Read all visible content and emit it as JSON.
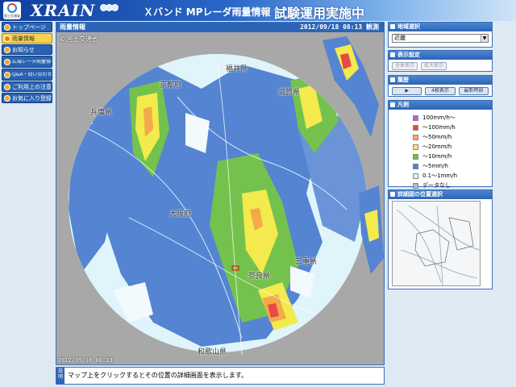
{
  "header": {
    "brand": "XRAIN",
    "title": "Ｘバンド MPレーダ雨量情報",
    "subtitle": "試験運用実施中",
    "badge_text": "国土交通省"
  },
  "nav": {
    "items": [
      {
        "label": "トップページ",
        "active": false
      },
      {
        "label": "雨量情報",
        "active": true
      },
      {
        "label": "お知らせ",
        "active": false
      },
      {
        "label": "広域レーダ雨量情報へ",
        "active": false
      },
      {
        "label": "Q&A・問い合わせ",
        "active": false
      },
      {
        "label": "ご利用上の注意",
        "active": false
      },
      {
        "label": "お気に入り登録",
        "active": false
      }
    ]
  },
  "map": {
    "panel_title": "雨量情報",
    "timestamp": "2012/09/18 08:13 観測",
    "copyright": "©国土交通省",
    "overlay_time": "2012/09/18 08:13",
    "labels": [
      {
        "text": "福井県"
      },
      {
        "text": "京都府"
      },
      {
        "text": "滋賀県"
      },
      {
        "text": "兵庫県"
      },
      {
        "text": "大阪府"
      },
      {
        "text": "三重県"
      },
      {
        "text": "奈良県"
      },
      {
        "text": "和歌山県"
      }
    ]
  },
  "footnote": {
    "tag": "説明",
    "text": "マップ上をクリックするとその位置の詳細画面を表示します。"
  },
  "right": {
    "region": {
      "title": "地域選択",
      "selected": "近畿"
    },
    "display": {
      "title": "表示設定",
      "btn1": "全体表示",
      "btn2": "拡大表示"
    },
    "history": {
      "title": "履歴",
      "btn_play": "▶",
      "btn_back": "4枚表示",
      "btn_latest": "最新時刻"
    },
    "legend": {
      "title": "凡例",
      "items": [
        {
          "label": "100mm/h～",
          "color": "#c060d0"
        },
        {
          "label": "～100mm/h",
          "color": "#e84848"
        },
        {
          "label": "～50mm/h",
          "color": "#f4b04a"
        },
        {
          "label": "～20mm/h",
          "color": "#f4ec4a"
        },
        {
          "label": "～10mm/h",
          "color": "#6cc04a"
        },
        {
          "label": "～5mm/h",
          "color": "#4f7fd0"
        },
        {
          "label": "0.1～1mm/h",
          "color": "#d6f2fb"
        },
        {
          "label": "データなし",
          "color": "#b8b8b8"
        }
      ]
    },
    "detail": {
      "title": "詳細図の位置選択"
    }
  },
  "colors": {
    "header_dark": "#0f3f9c",
    "panel_blue": "#2c65b6",
    "rain_light": "#d6f2fb",
    "rain_5": "#4f7fd0",
    "rain_10": "#6cc04a",
    "rain_20": "#f4ec4a",
    "rain_50": "#f4b04a",
    "rain_100": "#e84848",
    "no_data": "#a8a8a8"
  }
}
